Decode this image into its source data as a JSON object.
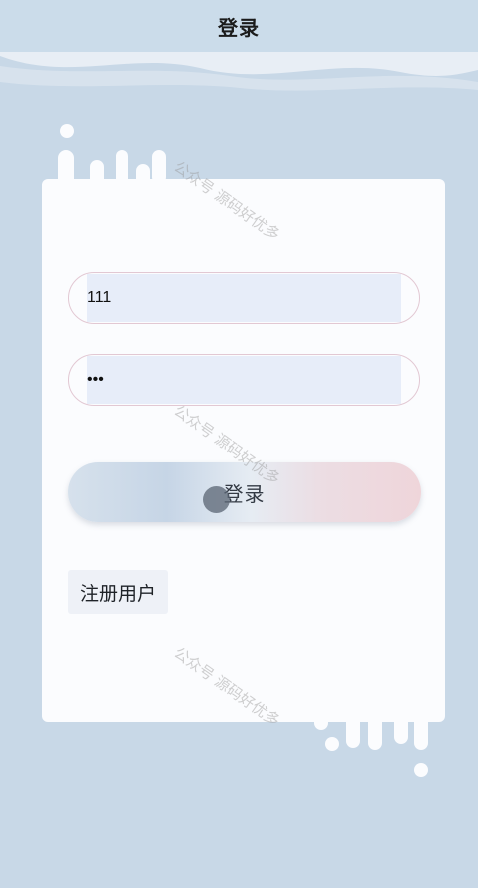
{
  "header": {
    "title": "登录"
  },
  "form": {
    "username_value": "111",
    "password_value": "111",
    "login_label": "登录",
    "register_label": "注册用户"
  },
  "watermark": {
    "text": "公众号 源码好优多"
  },
  "colors": {
    "background": "#c8d8e7",
    "card": "#fbfcfe",
    "input_fill": "#e7edf9",
    "input_border": "#e2c8d3",
    "button_gradient_left": "#c6d5e6",
    "button_gradient_right": "#efd5da"
  }
}
